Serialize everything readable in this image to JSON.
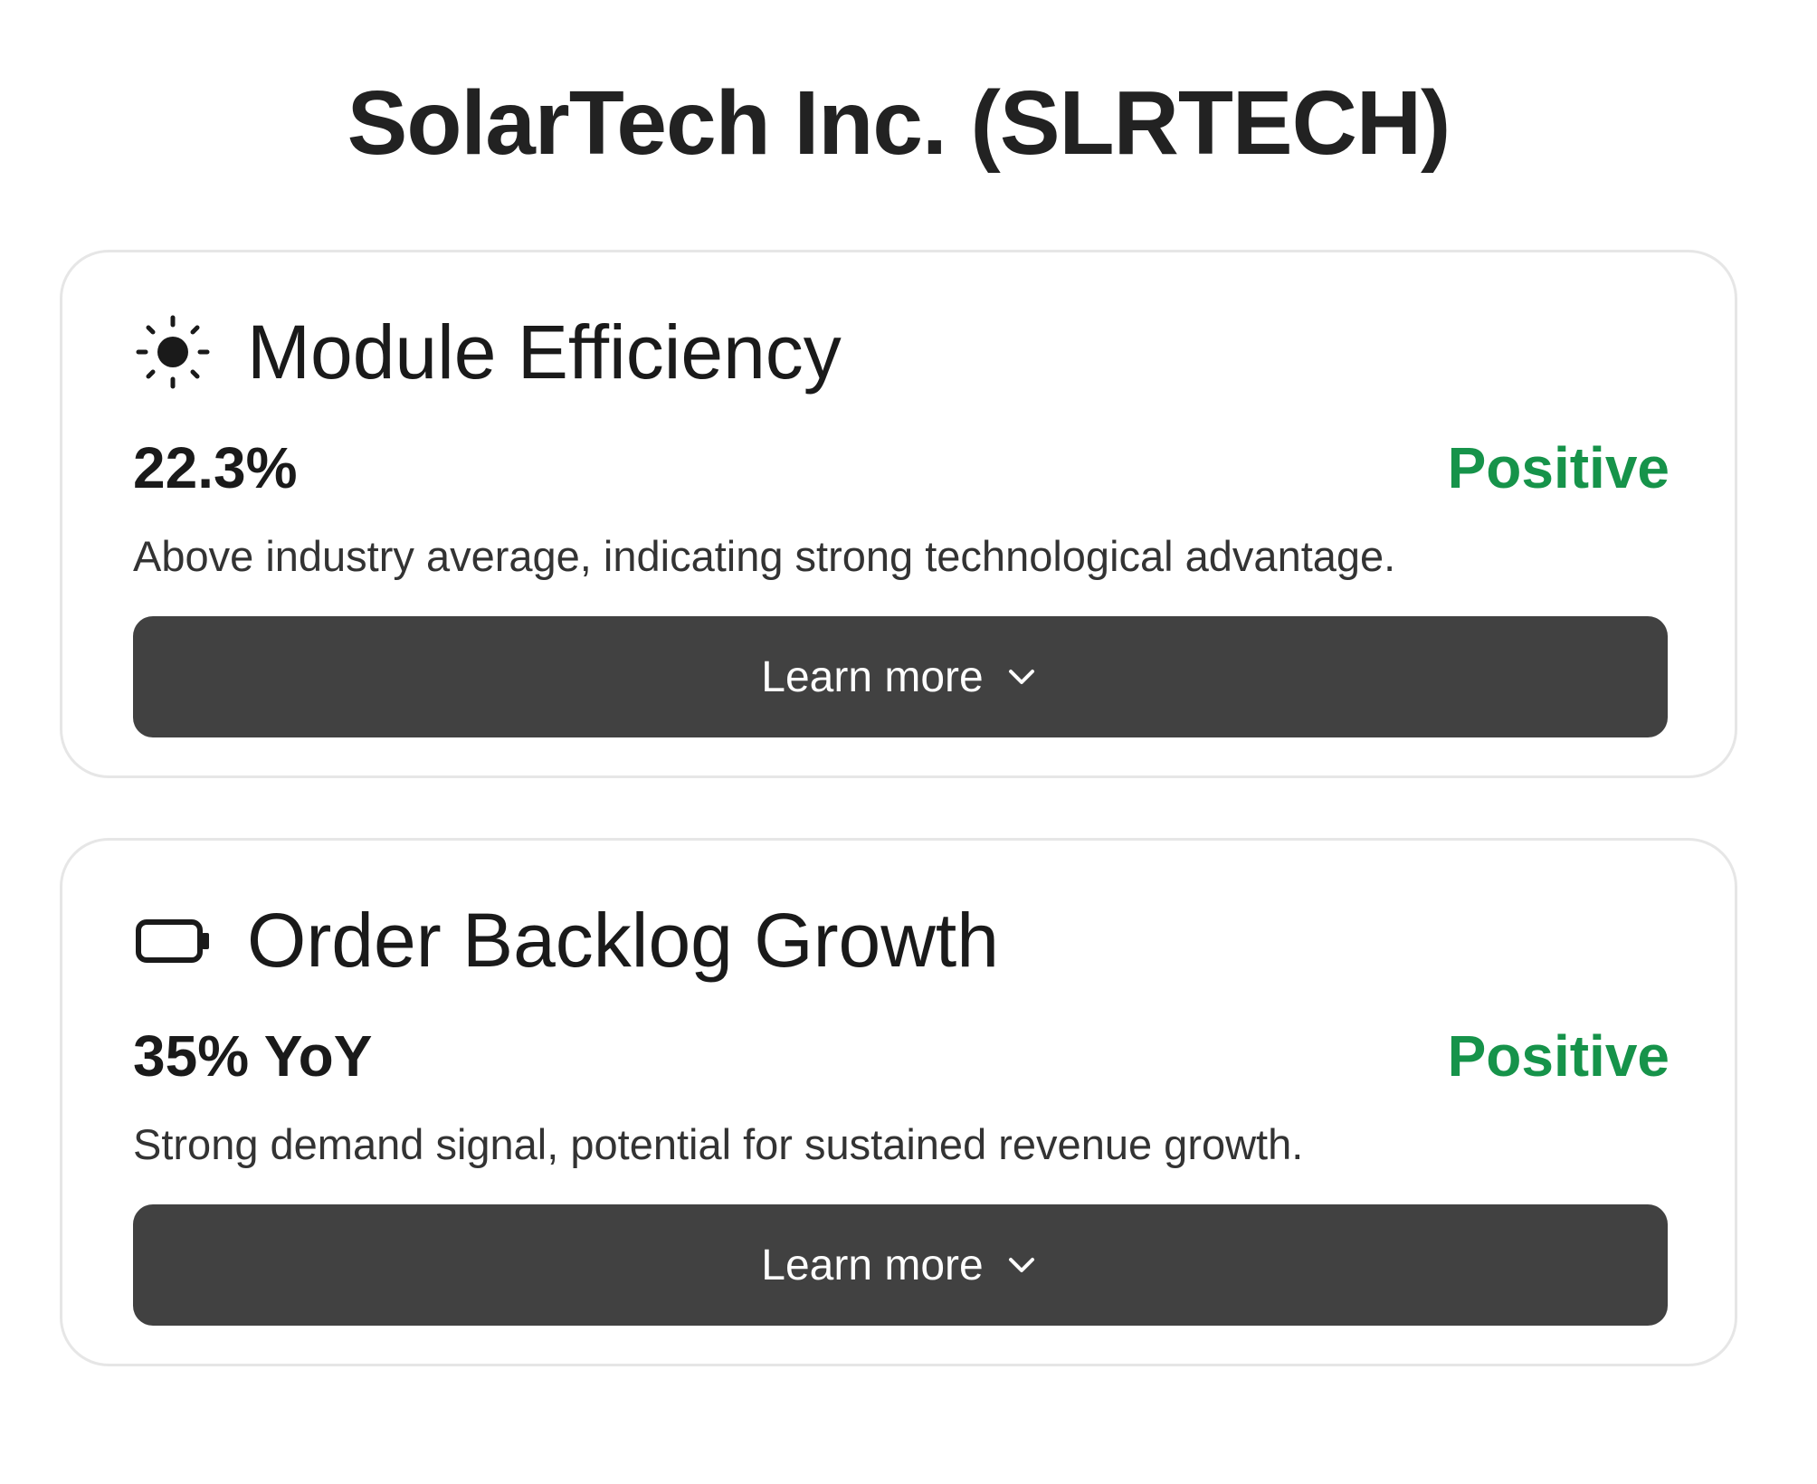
{
  "page": {
    "title": "SolarTech Inc. (SLRTECH)"
  },
  "colors": {
    "positive": "#16934a",
    "button_bg": "#414141",
    "card_border": "#e6e6e6"
  },
  "cards": [
    {
      "icon": "sun-icon",
      "title": "Module Efficiency",
      "value": "22.3%",
      "status": "Positive",
      "description": "Above industry average, indicating strong technological advantage.",
      "button_label": "Learn more"
    },
    {
      "icon": "battery-icon",
      "title": "Order Backlog Growth",
      "value": "35% YoY",
      "status": "Positive",
      "description": "Strong demand signal, potential for sustained revenue growth.",
      "button_label": "Learn more"
    }
  ]
}
